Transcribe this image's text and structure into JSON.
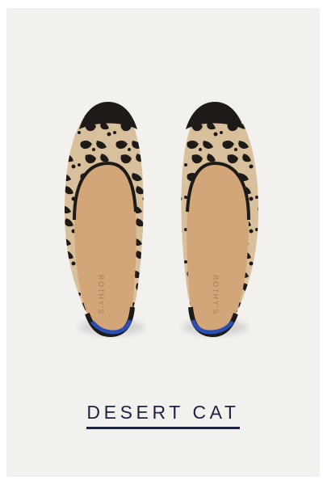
{
  "product": {
    "colorway_name": "DESERT CAT",
    "insole_brand": "ROTHY'S",
    "colors": {
      "background": "#f3f1ee",
      "caption": "#1c2342",
      "insole": "#d3a679",
      "knit_base": "#d9c09c",
      "knit_spots": "#1d1a18",
      "heel_stripe": "#2a4fb4"
    }
  }
}
